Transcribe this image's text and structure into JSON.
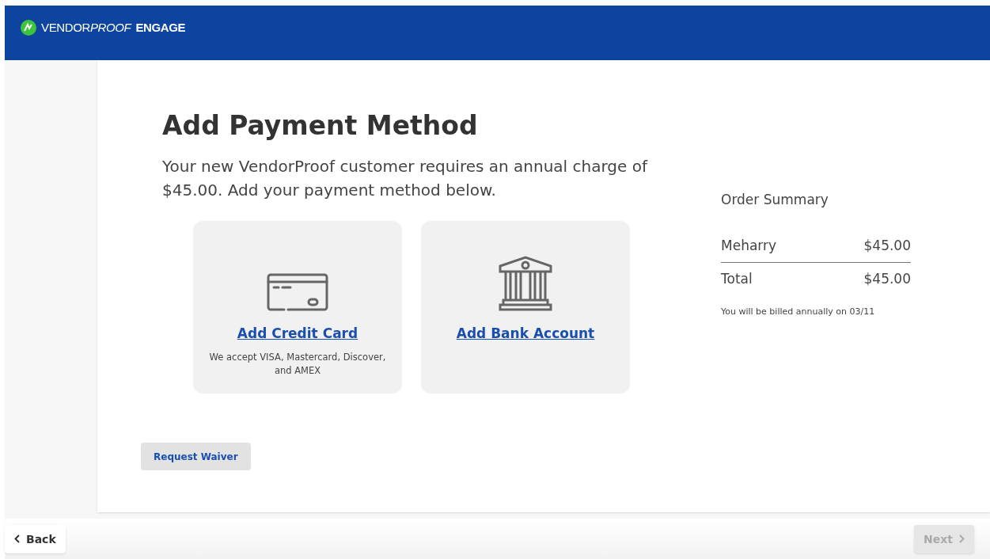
{
  "header": {
    "logo_parts": [
      {
        "text": "VENDOR",
        "kind": "regular"
      },
      {
        "text": "PROOF",
        "kind": "italic"
      },
      {
        "text": "ENGAGE",
        "kind": "bold"
      }
    ]
  },
  "page": {
    "title": "Add Payment Method",
    "intro": "Your new VendorProof customer requires an annual charge of $45.00. Add your payment method below."
  },
  "options": [
    {
      "kind": "card",
      "link": "Add Credit Card",
      "note": "We accept VISA, Mastercard, Discover, and AMEX"
    },
    {
      "kind": "bank",
      "link": "Add Bank Account"
    }
  ],
  "order_summary": {
    "title": "Order Summary",
    "items": [
      {
        "label": "Meharry",
        "amount": "$45.00"
      }
    ],
    "total_label": "Total",
    "total_amount": "$45.00",
    "billing_note": "You will be billed annually on 03/11"
  },
  "request_waiver": "Request Waiver",
  "footer": {
    "back": {
      "label": "Back",
      "disabled": false
    },
    "next": {
      "label": "Next",
      "disabled": true
    }
  }
}
